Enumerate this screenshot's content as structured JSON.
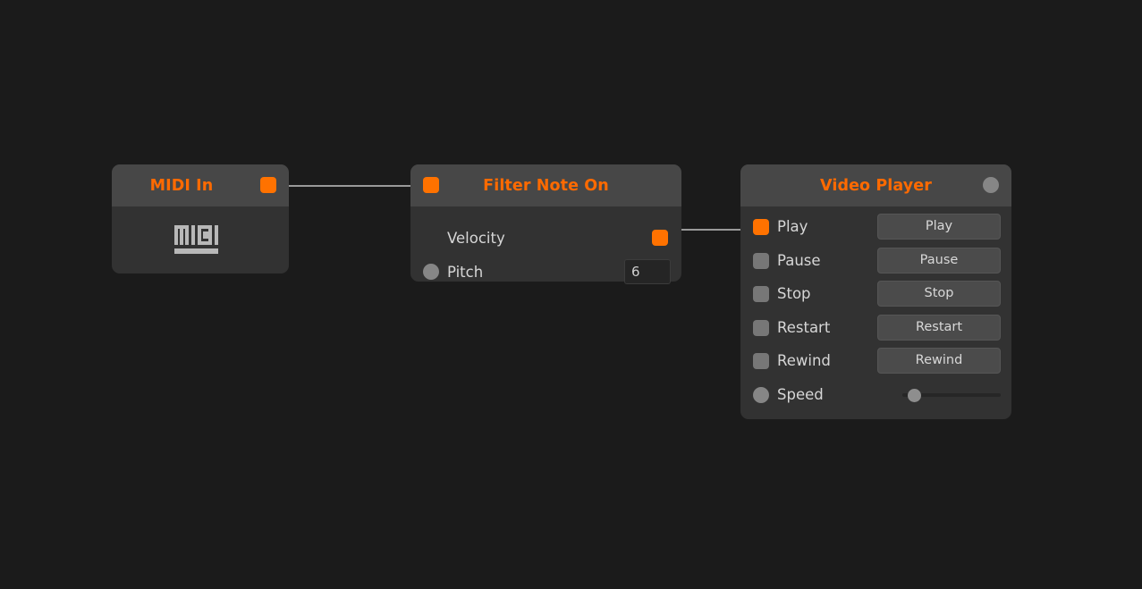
{
  "canvas": {
    "background": "#1b1b1b",
    "accent_color": "#ff6a00",
    "port_on_color": "#ff7200",
    "port_off_color": "#777777",
    "node_header_color": "#474747",
    "node_body_color": "#323232",
    "wire_color": "#9a9a9a"
  },
  "nodes": {
    "midi_in": {
      "title": "MIDI In",
      "output_port": "output-port",
      "logo_label": "MIDI"
    },
    "filter_note_on": {
      "title": "Filter Note On",
      "input_port": "input-port",
      "rows": [
        {
          "label": "Velocity",
          "port": "on",
          "control": "none"
        },
        {
          "label": "Pitch",
          "port": "circle",
          "control": "number",
          "value": "6"
        }
      ]
    },
    "video_player": {
      "title": "Video Player",
      "header_port": "circle",
      "rows": [
        {
          "label": "Play",
          "port": "on",
          "control": "button",
          "button_label": "Play"
        },
        {
          "label": "Pause",
          "port": "off",
          "control": "button",
          "button_label": "Pause"
        },
        {
          "label": "Stop",
          "port": "off",
          "control": "button",
          "button_label": "Stop"
        },
        {
          "label": "Restart",
          "port": "off",
          "control": "button",
          "button_label": "Restart"
        },
        {
          "label": "Rewind",
          "port": "off",
          "control": "button",
          "button_label": "Rewind"
        },
        {
          "label": "Speed",
          "port": "circle",
          "control": "slider",
          "slider_value": 6
        }
      ]
    }
  },
  "connections": [
    {
      "from": "midi_in.output",
      "to": "filter_note_on.input"
    },
    {
      "from": "filter_note_on.velocity",
      "to": "video_player.play"
    }
  ]
}
